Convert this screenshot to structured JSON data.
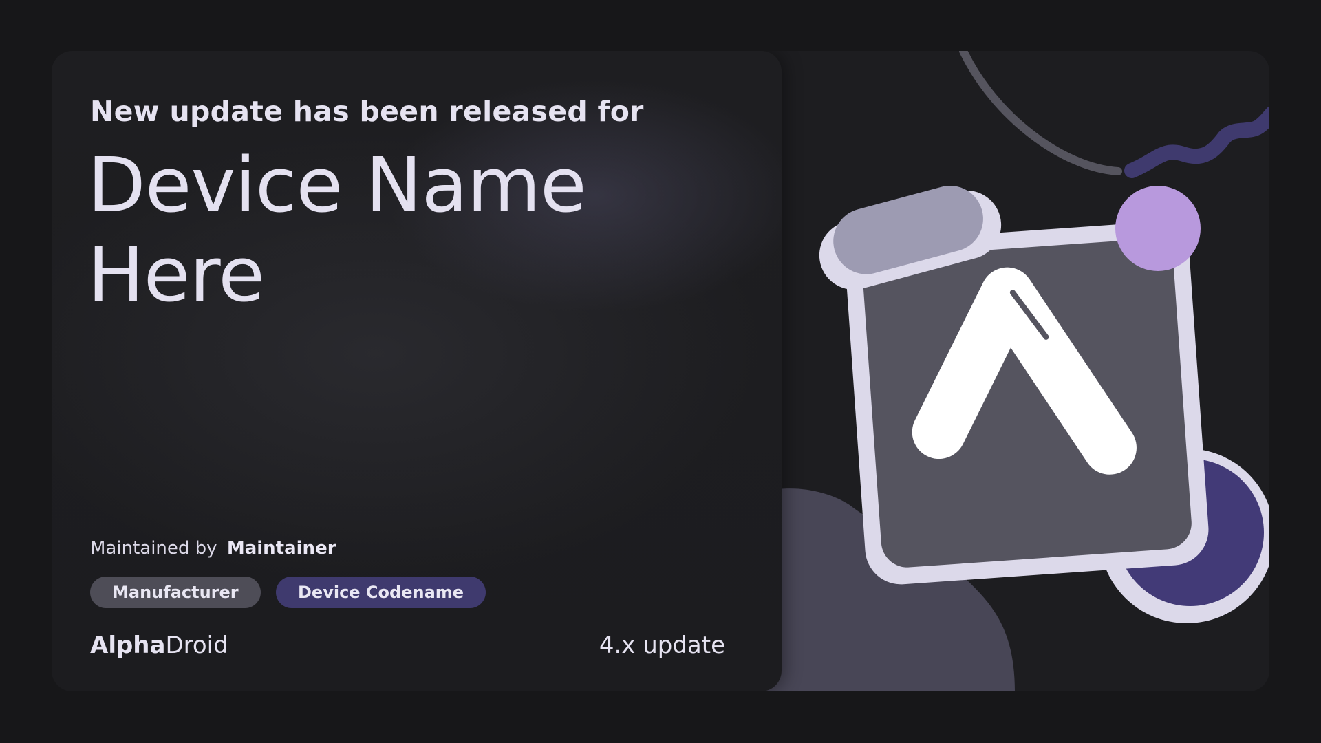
{
  "banner": {
    "intro": "New update has been released for",
    "device_name": "Device Name Here",
    "maintained_by_label": "Maintained by",
    "maintainer": "Maintainer",
    "manufacturer": "Manufacturer",
    "codename": "Device Codename",
    "brand_bold": "Alpha",
    "brand_regular": "Droid",
    "version": "4.x update"
  },
  "illustration": {
    "logo_icon": "alphadroid-logo-icon",
    "colors": {
      "tile_border": "#dcd9ea",
      "tile_fill": "#55545f",
      "pill_fill": "#9d9bb2",
      "violet_dot": "#b899dd",
      "indigo_circle": "#423a77",
      "blob": "#484656",
      "arc": "#55545e",
      "wave": "#3f3a6e"
    }
  }
}
